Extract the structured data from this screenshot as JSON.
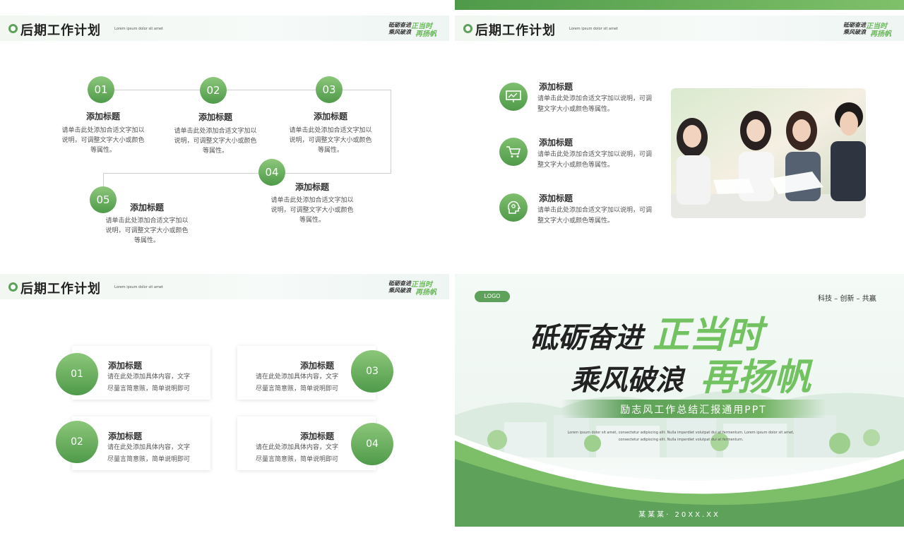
{
  "header": {
    "title": "后期工作计划",
    "subtitle": "Lorem ipsum dolor sit amet",
    "brand_line1": "砥砺奋进",
    "brand_line2": "乘风破浪",
    "brand_accent1": "正当时",
    "brand_accent2": "再扬帆"
  },
  "slide1": {
    "steps": [
      {
        "num": "01",
        "title": "添加标题",
        "desc": "请单击此处添加合适文字加以说明，可调整文字大小或颜色等属性。"
      },
      {
        "num": "02",
        "title": "添加标题",
        "desc": "请单击此处添加合适文字加以说明，可调整文字大小或颜色等属性。"
      },
      {
        "num": "03",
        "title": "添加标题",
        "desc": "请单击此处添加合适文字加以说明，可调整文字大小或颜色等属性。"
      },
      {
        "num": "04",
        "title": "添加标题",
        "desc": "请单击此处添加合适文字加以说明，可调整文字大小或颜色等属性。"
      },
      {
        "num": "05",
        "title": "添加标题",
        "desc": "请单击此处添加合适文字加以说明，可调整文字大小或颜色等属性。"
      }
    ]
  },
  "slide2": {
    "items": [
      {
        "icon": "presentation-icon",
        "title": "添加标题",
        "desc": "请单击此处添加合适文字加以说明，可调整文字大小或颜色等属性。"
      },
      {
        "icon": "cart-icon",
        "title": "添加标题",
        "desc": "请单击此处添加合适文字加以说明，可调整文字大小或颜色等属性。"
      },
      {
        "icon": "head-gear-icon",
        "title": "添加标题",
        "desc": "请单击此处添加合适文字加以说明，可调整文字大小或颜色等属性。"
      }
    ]
  },
  "slide3": {
    "cards": [
      {
        "num": "01",
        "title": "添加标题",
        "desc1": "请在此处添加具体内容，文字",
        "desc2": "尽量言简意赅，简单说明即可"
      },
      {
        "num": "03",
        "title": "添加标题",
        "desc1": "请在此处添加具体内容，文字",
        "desc2": "尽量言简意赅，简单说明即可"
      },
      {
        "num": "02",
        "title": "添加标题",
        "desc1": "请在此处添加具体内容，文字",
        "desc2": "尽量言简意赅，简单说明即可"
      },
      {
        "num": "04",
        "title": "添加标题",
        "desc1": "请在此处添加具体内容，文字",
        "desc2": "尽量言简意赅，简单说明即可"
      }
    ]
  },
  "slide4": {
    "logo": "LOGO",
    "tagline": "科技 – 创新 – 共赢",
    "line1": "砥砺奋进",
    "line2": "乘风破浪",
    "accent1": "正当时",
    "accent2": "再扬帆",
    "banner": "励志风工作总结汇报通用PPT",
    "lorem1": "Lorem ipsum dolor sit amet, consectetur adipiscing elit. Nulla imperdiet volutpat dui at fermentum. Lorem ipsum dolor sit amet,",
    "lorem2": "consectetur adipiscing elit. Nulla imperdiet volutpat dui at fermentum.",
    "footer": "某某某·  20XX.XX"
  },
  "colors": {
    "accent": "#5ea15a",
    "accent_light": "#8cc77a",
    "text": "#333333"
  }
}
